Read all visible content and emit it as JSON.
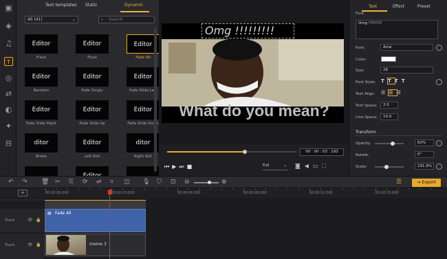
{
  "panel": {
    "tabs": [
      "Text templates",
      "Static",
      "Dynamic"
    ],
    "filter": "All (41)",
    "search_placeholder": "Search",
    "templates": [
      {
        "preview": "Editor",
        "label": "Flash"
      },
      {
        "preview": "Editor",
        "label": "Float"
      },
      {
        "preview": "Editor",
        "label": "Fade All"
      },
      {
        "preview": "Editor",
        "label": "Random"
      },
      {
        "preview": "Editor",
        "label": "Fade Singly"
      },
      {
        "preview": "Editor",
        "label": "Fade Slide Left"
      },
      {
        "preview": "Editor",
        "label": "Fade Slide Right"
      },
      {
        "preview": "Editor",
        "label": "Fade Slide Up"
      },
      {
        "preview": "Editor",
        "label": "Fade Slide Down"
      },
      {
        "preview": "ditor",
        "label": "Brake"
      },
      {
        "preview": "Editor",
        "label": "Left Roll"
      },
      {
        "preview": "ditor",
        "label": "Right Roll"
      },
      {
        "preview": "",
        "label": ""
      },
      {
        "preview": "Editor",
        "label": ""
      },
      {
        "preview": "",
        "label": ""
      }
    ]
  },
  "preview": {
    "overlay_top": "Omg !!!!!!!!!",
    "overlay_bottom": "What do you mean?",
    "timecode": "00 : 00 : 03 . 193",
    "quality": "Full",
    "progress": 0.6
  },
  "right": {
    "tabs": [
      "Text",
      "Effect",
      "Preset"
    ],
    "font_heading": "Font",
    "text_value": "Omg !!!!!!!!!",
    "font_label": "Font:",
    "font_value": "Arial",
    "color_label": "Color:",
    "size_label": "Size:",
    "size_value": "28",
    "style_label": "Font Style:",
    "style_buttons": [
      "T",
      "T",
      "T",
      "T"
    ],
    "align_label": "Text Align:",
    "space_label": "Text Space:",
    "space_value": "2.0",
    "line_label": "Line Space:",
    "line_value": "10.0",
    "transform_heading": "Transform",
    "opacity_label": "Opacity:",
    "opacity_value": "62%",
    "opacity_level": 0.62,
    "rotate_label": "Rotate:",
    "rotate_value": "0°",
    "scale_label": "Scale:",
    "scale_value": "191.9%",
    "scale_level": 0.4
  },
  "toolbar": {
    "export_label": "Export"
  },
  "ruler": {
    "times": [
      "00:00:00.000",
      "00:00:03.000",
      "00:00:06.000",
      "00:00:09.000",
      "00:00:12.000",
      "00:00:15.000"
    ]
  },
  "tracks": {
    "track_label": "Track",
    "text_clip": "Fade All",
    "video_clip": "meme 3"
  }
}
